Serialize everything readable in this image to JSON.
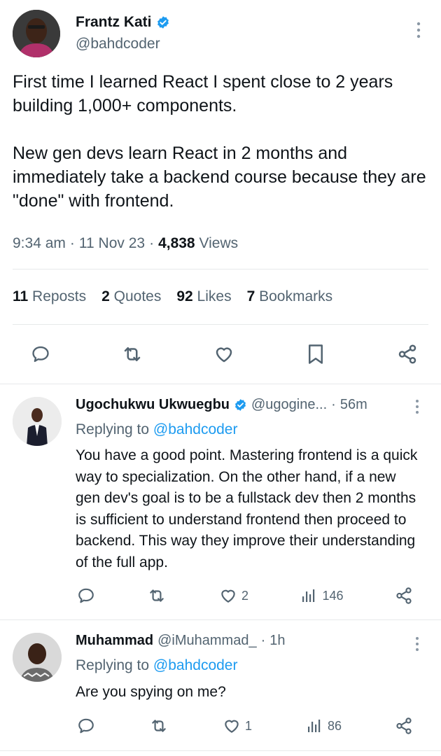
{
  "main_tweet": {
    "author_name": "Frantz Kati",
    "author_handle": "@bahdcoder",
    "text": "First time I learned React I spent close to 2 years building 1,000+ components.\n\nNew gen devs learn React in 2 months and immediately take a backend course because they are \"done\" with frontend.",
    "time": "9:34 am",
    "date": "11 Nov 23",
    "views_count": "4,838",
    "views_label": "Views",
    "stats": {
      "reposts_count": "11",
      "reposts_label": "Reposts",
      "quotes_count": "2",
      "quotes_label": "Quotes",
      "likes_count": "92",
      "likes_label": "Likes",
      "bookmarks_count": "7",
      "bookmarks_label": "Bookmarks"
    }
  },
  "replies": [
    {
      "author_name": "Ugochukwu Ukwuegbu",
      "verified": true,
      "author_handle": "@ugogine...",
      "age": "56m",
      "replying_prefix": "Replying to",
      "replying_to": "@bahdcoder",
      "text": "You have a good point. Mastering frontend is a quick way to specialization. On the other hand, if a new gen dev's goal is to be a fullstack dev then 2 months is sufficient to understand frontend then proceed to backend. This way they improve their understanding of the full app.",
      "likes": "2",
      "views": "146"
    },
    {
      "author_name": "Muhammad",
      "verified": false,
      "author_handle": "@iMuhammad_",
      "age": "1h",
      "replying_prefix": "Replying to",
      "replying_to": "@bahdcoder",
      "text": "Are you spying on me?",
      "likes": "1",
      "views": "86"
    }
  ],
  "colors": {
    "text": "#0f1419",
    "muted": "#536471",
    "accent": "#1d9bf0",
    "divider": "#e7e9ea"
  },
  "icons": [
    "verified-badge-icon",
    "more-icon",
    "reply-icon",
    "repost-icon",
    "like-icon",
    "bookmark-icon",
    "share-icon",
    "views-icon"
  ]
}
